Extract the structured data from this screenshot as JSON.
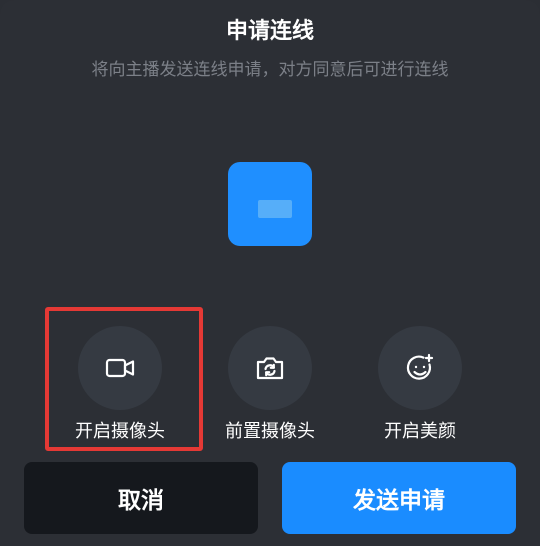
{
  "dialog": {
    "title": "申请连线",
    "subtitle": "将向主播发送连线申请，对方同意后可进行连线"
  },
  "options": [
    {
      "label": "开启摄像头",
      "icon": "video-camera-icon"
    },
    {
      "label": "前置摄像头",
      "icon": "switch-camera-icon"
    },
    {
      "label": "开启美颜",
      "icon": "beauty-face-icon"
    }
  ],
  "buttons": {
    "cancel_label": "取消",
    "send_label": "发送申请"
  },
  "colors": {
    "background": "#2c2f35",
    "accent": "#1a8cff",
    "highlight": "#e53935",
    "option_circle": "#353a42",
    "cancel_bg": "#15181d"
  }
}
